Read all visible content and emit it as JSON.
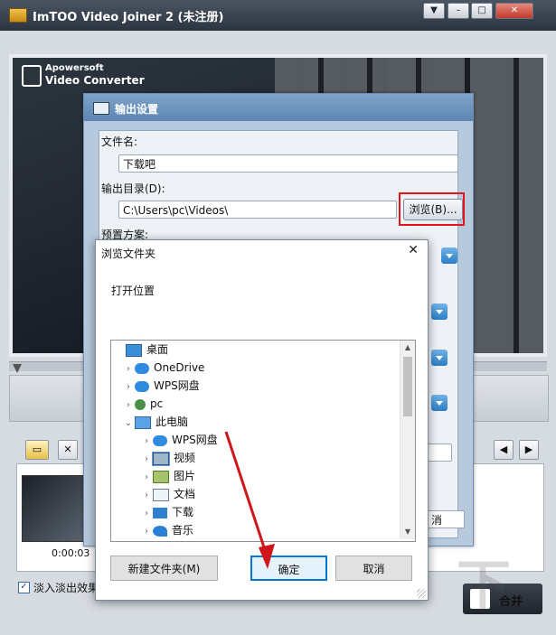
{
  "app": {
    "title": "ImTOO Video Joiner 2 (未注册)",
    "window_buttons": {
      "minimize": "▼",
      "restore": "–",
      "maximize": "□",
      "close": "✕"
    },
    "preview": {
      "logo_line1": "Apowersoft",
      "logo_line2": "Video Converter"
    },
    "thumbnail_time": "0:00:03",
    "fade_checked": true,
    "fade_label": "淡入淡出效果",
    "merge_label": "合并"
  },
  "output_dialog": {
    "title": "输出设置",
    "filename_label": "文件名:",
    "filename_value": "下载吧",
    "output_dir_label": "输出目录(D):",
    "output_dir_value": "C:\\Users\\pc\\Videos\\",
    "browse_label": "浏览(B)...",
    "preset_label": "预置方案:",
    "partial_button_label": "消"
  },
  "browse_dialog": {
    "title": "浏览文件夹",
    "close_label": "✕",
    "heading": "打开位置",
    "tree": [
      {
        "label": "桌面",
        "icon": "desktop-icon",
        "level": 0,
        "chevron": ""
      },
      {
        "label": "OneDrive",
        "icon": "cloud-icon",
        "level": 1,
        "chevron": "›"
      },
      {
        "label": "WPS网盘",
        "icon": "cloud-icon",
        "level": 1,
        "chevron": "›"
      },
      {
        "label": "pc",
        "icon": "user-icon",
        "level": 1,
        "chevron": "›"
      },
      {
        "label": "此电脑",
        "icon": "computer-icon",
        "level": 1,
        "chevron": "⌄"
      },
      {
        "label": "WPS网盘",
        "icon": "cloud-icon",
        "level": 2,
        "chevron": "›"
      },
      {
        "label": "视频",
        "icon": "video-folder-icon",
        "level": 2,
        "chevron": "›",
        "selected": true
      },
      {
        "label": "图片",
        "icon": "pictures-folder-icon",
        "level": 2,
        "chevron": "›"
      },
      {
        "label": "文档",
        "icon": "documents-folder-icon",
        "level": 2,
        "chevron": "›"
      },
      {
        "label": "下载",
        "icon": "download-folder-icon",
        "level": 2,
        "chevron": "›"
      },
      {
        "label": "音乐",
        "icon": "music-folder-icon",
        "level": 2,
        "chevron": "›"
      }
    ],
    "new_folder_label": "新建文件夹(M)",
    "ok_label": "确定",
    "cancel_label": "取消"
  },
  "colors": {
    "highlight_red": "#e0161b",
    "accent_blue": "#0078d7"
  }
}
